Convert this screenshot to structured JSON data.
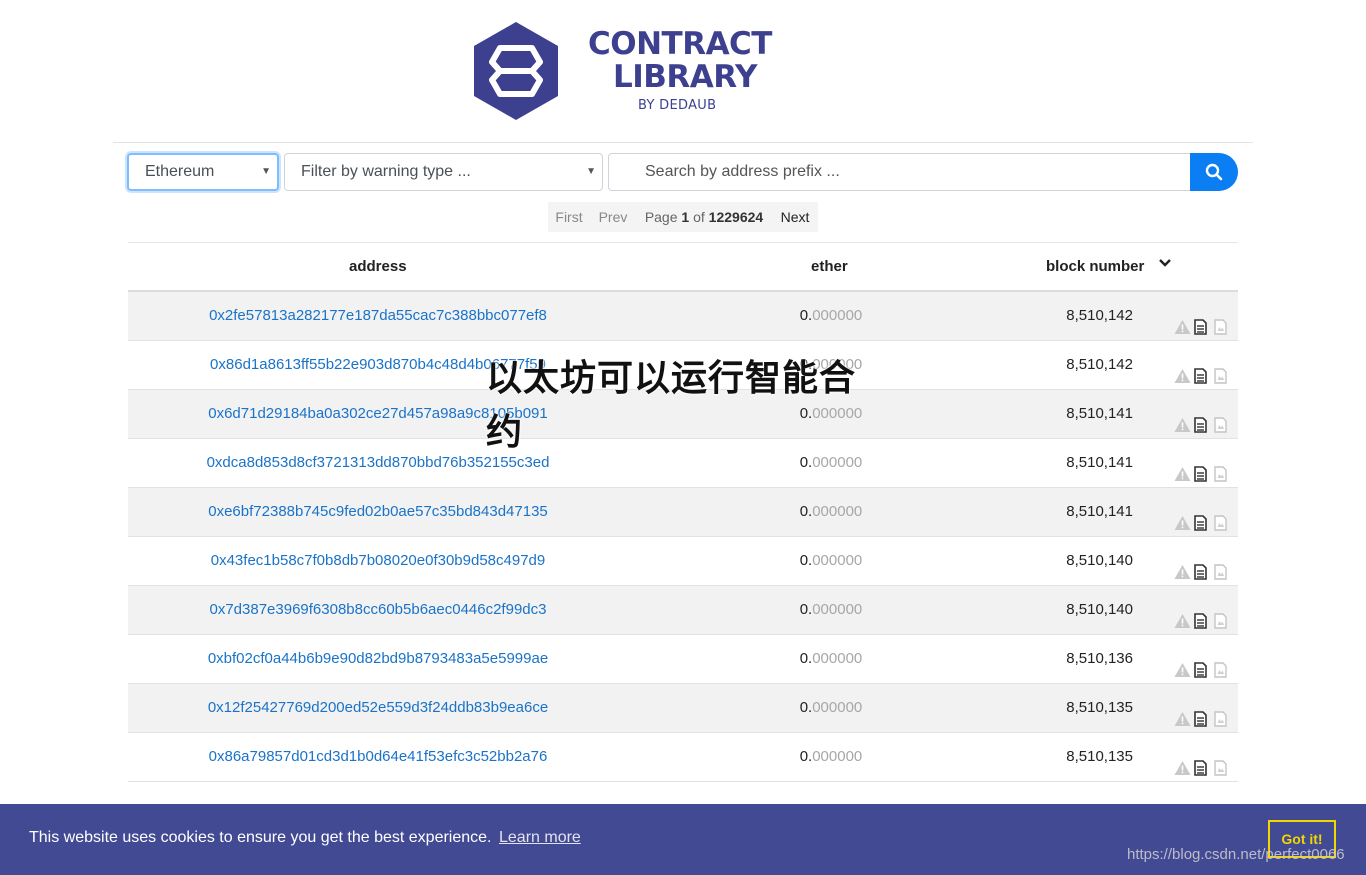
{
  "logo": {
    "line1": "CONTRACT",
    "line2": "LIBRARY",
    "line3": "BY DEDAUB",
    "brand_color": "#3d3f8f"
  },
  "filters": {
    "network_selected": "Ethereum",
    "warning_placeholder": "Filter by warning type ...",
    "search_placeholder": "Search by address prefix ..."
  },
  "pagination": {
    "first": "First",
    "prev": "Prev",
    "page_prefix": "Page",
    "page_current": "1",
    "page_of": "of",
    "page_total": "1229624",
    "next": "Next"
  },
  "table": {
    "columns": [
      "address",
      "ether",
      "block number"
    ],
    "rows": [
      {
        "address": "0x2fe57813a282177e187da55cac7c388bbc077ef8",
        "ether_int": "0.",
        "ether_dec": "000000",
        "block": "8,510,142"
      },
      {
        "address": "0x86d1a8613ff55b22e903d870b4c48d4b06777f59",
        "ether_int": "0.",
        "ether_dec": "000000",
        "block": "8,510,142"
      },
      {
        "address": "0x6d71d29184ba0a302ce27d457a98a9c8105b091",
        "ether_int": "0.",
        "ether_dec": "000000",
        "block": "8,510,141"
      },
      {
        "address": "0xdca8d853d8cf3721313dd870bbd76b352155c3ed",
        "ether_int": "0.",
        "ether_dec": "000000",
        "block": "8,510,141"
      },
      {
        "address": "0xe6bf72388b745c9fed02b0ae57c35bd843d47135",
        "ether_int": "0.",
        "ether_dec": "000000",
        "block": "8,510,141"
      },
      {
        "address": "0x43fec1b58c7f0b8db7b08020e0f30b9d58c497d9",
        "ether_int": "0.",
        "ether_dec": "000000",
        "block": "8,510,140"
      },
      {
        "address": "0x7d387e3969f6308b8cc60b5b6aec0446c2f99dc3",
        "ether_int": "0.",
        "ether_dec": "000000",
        "block": "8,510,140"
      },
      {
        "address": "0xbf02cf0a44b6b9e90d82bd9b8793483a5e5999ae",
        "ether_int": "0.",
        "ether_dec": "000000",
        "block": "8,510,136"
      },
      {
        "address": "0x12f25427769d200ed52e559d3f24ddb83b9ea6ce",
        "ether_int": "0.",
        "ether_dec": "000000",
        "block": "8,510,135"
      },
      {
        "address": "0x86a79857d01cd3d1b0d64e41f53efc3c52bb2a76",
        "ether_int": "0.",
        "ether_dec": "000000",
        "block": "8,510,135"
      }
    ],
    "row_icons": [
      "warning-icon",
      "source-document-icon",
      "decompiled-document-icon"
    ]
  },
  "overlay_caption": "以太坊可以运行智能合约",
  "cookie": {
    "message": "This website uses cookies to ensure you get the best experience.",
    "learn_more": "Learn more",
    "button": "Got it!",
    "bar_color": "#424a93",
    "button_color": "#f1d600"
  },
  "watermark": "https://blog.csdn.net/perfect0066",
  "accent_color": "#0b7ef4"
}
